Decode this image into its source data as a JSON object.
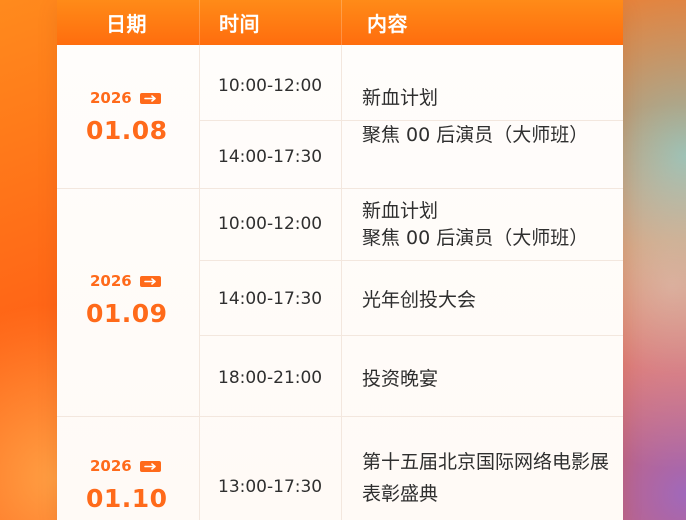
{
  "header": {
    "date_label": "日期",
    "time_label": "时间",
    "content_label": "内容"
  },
  "schedule": [
    {
      "year": "2026",
      "date": "01.08",
      "sessions": [
        {
          "time": "10:00-12:00",
          "content_lines": [
            "新血计划",
            "聚焦 00 后演员（大师班）"
          ]
        },
        {
          "time": "14:00-17:30",
          "content_lines": []
        }
      ]
    },
    {
      "year": "2026",
      "date": "01.09",
      "sessions": [
        {
          "time": "10:00-12:00",
          "content_lines": [
            "新血计划",
            "聚焦 00 后演员（大师班）"
          ]
        },
        {
          "time": "14:00-17:30",
          "content_lines": [
            "光年创投大会"
          ]
        },
        {
          "time": "18:00-21:00",
          "content_lines": [
            "投资晚宴"
          ]
        }
      ]
    },
    {
      "year": "2026",
      "date": "01.10",
      "sessions": [
        {
          "time": "13:00-17:30",
          "content_lines": [
            "第十五届北京国际网络电影展",
            "表彰盛典"
          ]
        }
      ]
    }
  ],
  "colors": {
    "accent": "#ff6a1a",
    "header_gradient_start": "#ff8b18",
    "header_gradient_end": "#ff6d0e",
    "text_primary": "#2f2f2f",
    "table_background": "#ffffff",
    "divider": "#f3e7de"
  },
  "icons": {
    "arrow_badge": "arrow-right-icon"
  }
}
